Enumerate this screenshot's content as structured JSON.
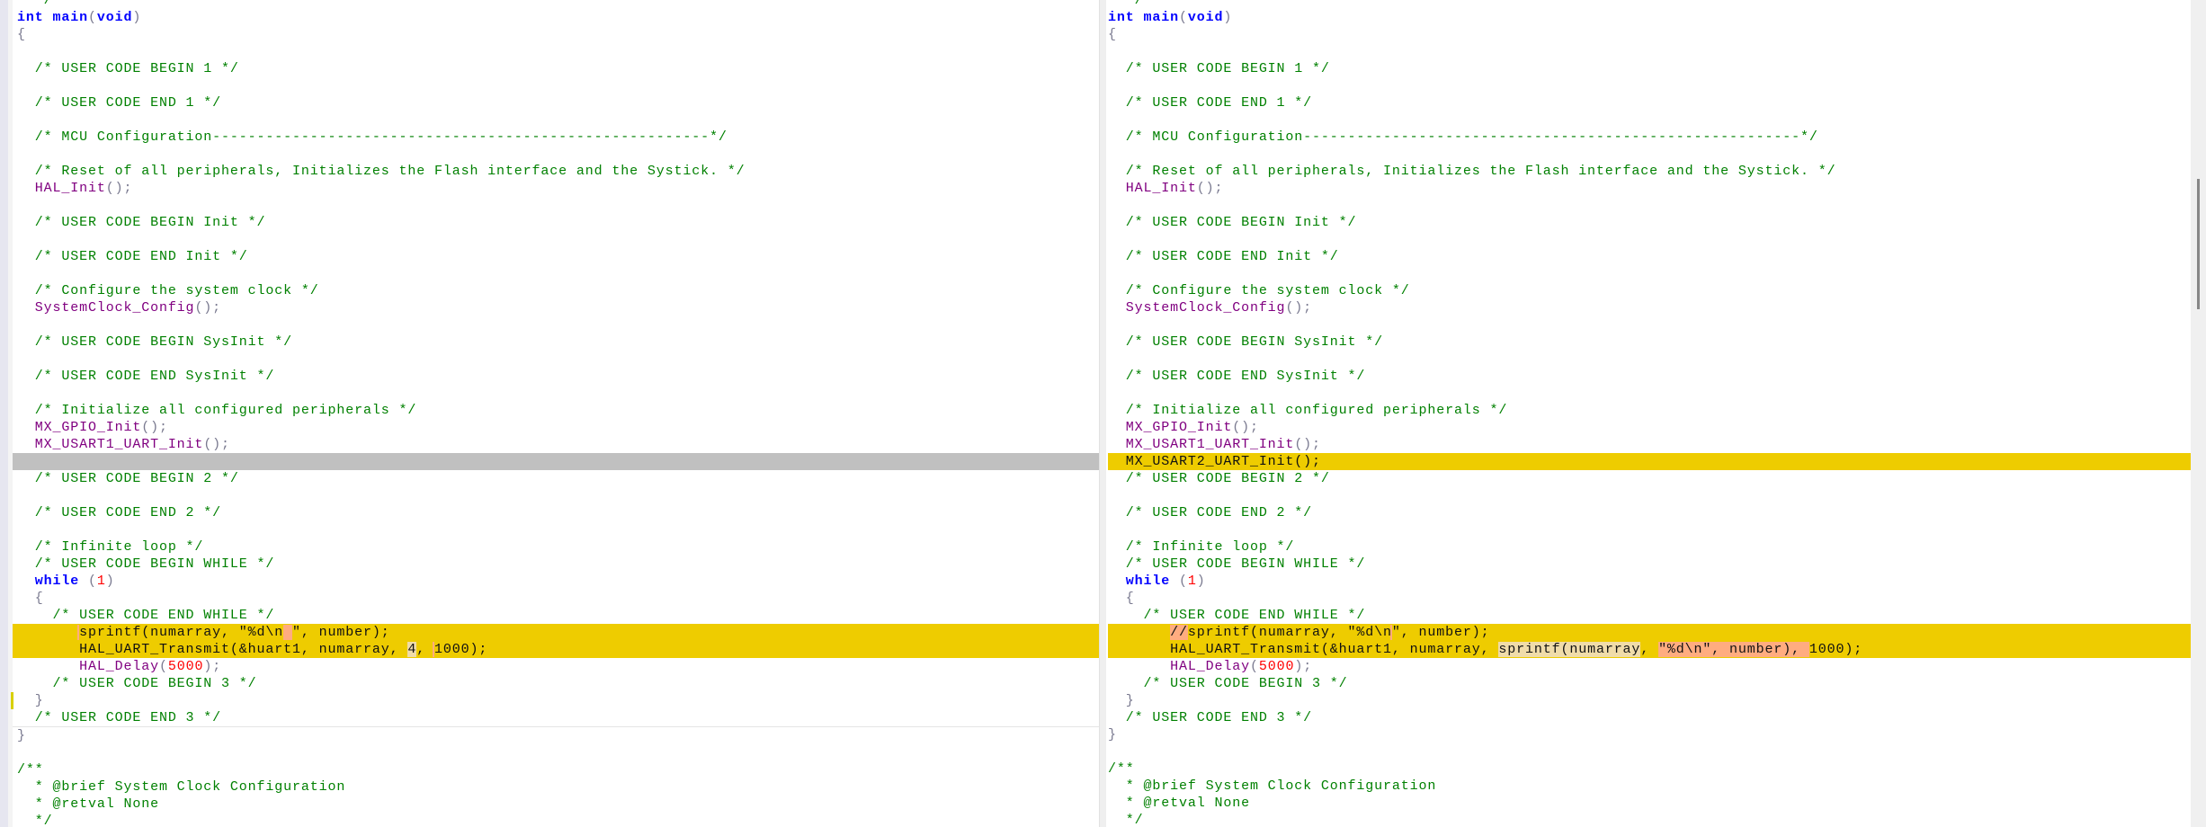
{
  "left": {
    "lines": [
      {
        "tokens": [
          {
            "t": "  */",
            "c": "c"
          }
        ]
      },
      {
        "tokens": [
          {
            "t": "int",
            "c": "k"
          },
          {
            "t": " ",
            "c": "t"
          },
          {
            "t": "main",
            "c": "k"
          },
          {
            "t": "(",
            "c": "p"
          },
          {
            "t": "void",
            "c": "k"
          },
          {
            "t": ")",
            "c": "p"
          }
        ]
      },
      {
        "tokens": [
          {
            "t": "{",
            "c": "p"
          }
        ]
      },
      {
        "tokens": []
      },
      {
        "tokens": [
          {
            "t": "  /* USER CODE BEGIN 1 */",
            "c": "c"
          }
        ]
      },
      {
        "tokens": []
      },
      {
        "tokens": [
          {
            "t": "  /* USER CODE END 1 */",
            "c": "c"
          }
        ]
      },
      {
        "tokens": []
      },
      {
        "tokens": [
          {
            "t": "  /* MCU Configuration--------------------------------------------------------*/",
            "c": "c"
          }
        ]
      },
      {
        "tokens": []
      },
      {
        "tokens": [
          {
            "t": "  /* Reset of all peripherals, Initializes the Flash interface and the Systick. */",
            "c": "c"
          }
        ]
      },
      {
        "tokens": [
          {
            "t": "  HAL_Init",
            "c": "f"
          },
          {
            "t": "();",
            "c": "p"
          }
        ]
      },
      {
        "tokens": []
      },
      {
        "tokens": [
          {
            "t": "  /* USER CODE BEGIN Init */",
            "c": "c"
          }
        ]
      },
      {
        "tokens": []
      },
      {
        "tokens": [
          {
            "t": "  /* USER CODE END Init */",
            "c": "c"
          }
        ]
      },
      {
        "tokens": []
      },
      {
        "tokens": [
          {
            "t": "  /* Configure the system clock */",
            "c": "c"
          }
        ]
      },
      {
        "tokens": [
          {
            "t": "  SystemClock_Config",
            "c": "f"
          },
          {
            "t": "();",
            "c": "p"
          }
        ]
      },
      {
        "tokens": []
      },
      {
        "tokens": [
          {
            "t": "  /* USER CODE BEGIN SysInit */",
            "c": "c"
          }
        ]
      },
      {
        "tokens": []
      },
      {
        "tokens": [
          {
            "t": "  /* USER CODE END SysInit */",
            "c": "c"
          }
        ]
      },
      {
        "tokens": []
      },
      {
        "tokens": [
          {
            "t": "  /* Initialize all configured peripherals */",
            "c": "c"
          }
        ]
      },
      {
        "tokens": [
          {
            "t": "  MX_GPIO_Init",
            "c": "f"
          },
          {
            "t": "();",
            "c": "p"
          }
        ]
      },
      {
        "tokens": [
          {
            "t": "  MX_USART1_UART_Init",
            "c": "f"
          },
          {
            "t": "();",
            "c": "p"
          }
        ]
      },
      {
        "hl": "gray",
        "tokens": []
      },
      {
        "tokens": [
          {
            "t": "  /* USER CODE BEGIN 2 */",
            "c": "c"
          }
        ]
      },
      {
        "tokens": []
      },
      {
        "tokens": [
          {
            "t": "  /* USER CODE END 2 */",
            "c": "c"
          }
        ]
      },
      {
        "tokens": []
      },
      {
        "tokens": [
          {
            "t": "  /* Infinite loop */",
            "c": "c"
          }
        ]
      },
      {
        "tokens": [
          {
            "t": "  /* USER CODE BEGIN WHILE */",
            "c": "c"
          }
        ]
      },
      {
        "tokens": [
          {
            "t": "  while",
            "c": "k"
          },
          {
            "t": " (",
            "c": "p"
          },
          {
            "t": "1",
            "c": "n"
          },
          {
            "t": ")",
            "c": "p"
          }
        ]
      },
      {
        "tokens": [
          {
            "t": "  {",
            "c": "p"
          }
        ]
      },
      {
        "tokens": [
          {
            "t": "    /* USER CODE END WHILE */",
            "c": "c"
          }
        ]
      },
      {
        "hl": "yellow",
        "tokens": [
          {
            "t": "       ",
            "c": "t"
          },
          {
            "t": "sprintf(numarray, \"%d\\n",
            "c": "t bar"
          },
          {
            "t": " ",
            "c": "hs"
          },
          {
            "t": "\", number);",
            "c": "t"
          }
        ]
      },
      {
        "hl": "yellow",
        "tokens": [
          {
            "t": "       HAL_UART_Transmit(&huart1, numarray, ",
            "c": "t"
          },
          {
            "t": "4",
            "c": "hb"
          },
          {
            "t": ", ",
            "c": "t"
          },
          {
            "t": "1000);",
            "c": "t bar"
          }
        ]
      },
      {
        "tokens": [
          {
            "t": "       HAL_Delay",
            "c": "f"
          },
          {
            "t": "(",
            "c": "p"
          },
          {
            "t": "5000",
            "c": "n"
          },
          {
            "t": ");",
            "c": "p"
          }
        ]
      },
      {
        "tokens": [
          {
            "t": "    /* USER CODE BEGIN 3 */",
            "c": "c"
          }
        ]
      },
      {
        "mark": true,
        "tokens": [
          {
            "t": "  }",
            "c": "p"
          }
        ]
      },
      {
        "sep": true,
        "tokens": [
          {
            "t": "  /* USER CODE END 3 */",
            "c": "c"
          }
        ]
      },
      {
        "tokens": [
          {
            "t": "}",
            "c": "p"
          }
        ]
      },
      {
        "tokens": []
      },
      {
        "tokens": [
          {
            "t": "/**",
            "c": "c"
          }
        ]
      },
      {
        "tokens": [
          {
            "t": "  * @brief System Clock Configuration",
            "c": "c"
          }
        ]
      },
      {
        "tokens": [
          {
            "t": "  * @retval None",
            "c": "c"
          }
        ]
      },
      {
        "tokens": [
          {
            "t": "  */",
            "c": "c"
          }
        ]
      }
    ]
  },
  "right": {
    "lines": [
      {
        "tokens": [
          {
            "t": "  */",
            "c": "c"
          }
        ]
      },
      {
        "tokens": [
          {
            "t": "int",
            "c": "k"
          },
          {
            "t": " ",
            "c": "t"
          },
          {
            "t": "main",
            "c": "k"
          },
          {
            "t": "(",
            "c": "p"
          },
          {
            "t": "void",
            "c": "k"
          },
          {
            "t": ")",
            "c": "p"
          }
        ]
      },
      {
        "tokens": [
          {
            "t": "{",
            "c": "p"
          }
        ]
      },
      {
        "tokens": []
      },
      {
        "tokens": [
          {
            "t": "  /* USER CODE BEGIN 1 */",
            "c": "c"
          }
        ]
      },
      {
        "tokens": []
      },
      {
        "tokens": [
          {
            "t": "  /* USER CODE END 1 */",
            "c": "c"
          }
        ]
      },
      {
        "tokens": []
      },
      {
        "tokens": [
          {
            "t": "  /* MCU Configuration--------------------------------------------------------*/",
            "c": "c"
          }
        ]
      },
      {
        "tokens": []
      },
      {
        "tokens": [
          {
            "t": "  /* Reset of all peripherals, Initializes the Flash interface and the Systick. */",
            "c": "c"
          }
        ]
      },
      {
        "tokens": [
          {
            "t": "  HAL_Init",
            "c": "f"
          },
          {
            "t": "();",
            "c": "p"
          }
        ]
      },
      {
        "tokens": []
      },
      {
        "tokens": [
          {
            "t": "  /* USER CODE BEGIN Init */",
            "c": "c"
          }
        ]
      },
      {
        "tokens": []
      },
      {
        "tokens": [
          {
            "t": "  /* USER CODE END Init */",
            "c": "c"
          }
        ]
      },
      {
        "tokens": []
      },
      {
        "tokens": [
          {
            "t": "  /* Configure the system clock */",
            "c": "c"
          }
        ]
      },
      {
        "tokens": [
          {
            "t": "  SystemClock_Config",
            "c": "f"
          },
          {
            "t": "();",
            "c": "p"
          }
        ]
      },
      {
        "tokens": []
      },
      {
        "tokens": [
          {
            "t": "  /* USER CODE BEGIN SysInit */",
            "c": "c"
          }
        ]
      },
      {
        "tokens": []
      },
      {
        "tokens": [
          {
            "t": "  /* USER CODE END SysInit */",
            "c": "c"
          }
        ]
      },
      {
        "tokens": []
      },
      {
        "tokens": [
          {
            "t": "  /* Initialize all configured peripherals */",
            "c": "c"
          }
        ]
      },
      {
        "tokens": [
          {
            "t": "  MX_GPIO_Init",
            "c": "f"
          },
          {
            "t": "();",
            "c": "p"
          }
        ]
      },
      {
        "tokens": [
          {
            "t": "  MX_USART1_UART_Init",
            "c": "f"
          },
          {
            "t": "();",
            "c": "p"
          }
        ]
      },
      {
        "hl": "yellow",
        "tokens": [
          {
            "t": "  MX_USART2_UART_Init();",
            "c": "t"
          }
        ]
      },
      {
        "tokens": [
          {
            "t": "  /* USER CODE BEGIN 2 */",
            "c": "c"
          }
        ]
      },
      {
        "tokens": []
      },
      {
        "tokens": [
          {
            "t": "  /* USER CODE END 2 */",
            "c": "c"
          }
        ]
      },
      {
        "tokens": []
      },
      {
        "tokens": [
          {
            "t": "  /* Infinite loop */",
            "c": "c"
          }
        ]
      },
      {
        "tokens": [
          {
            "t": "  /* USER CODE BEGIN WHILE */",
            "c": "c"
          }
        ]
      },
      {
        "tokens": [
          {
            "t": "  while",
            "c": "k"
          },
          {
            "t": " (",
            "c": "p"
          },
          {
            "t": "1",
            "c": "n"
          },
          {
            "t": ")",
            "c": "p"
          }
        ]
      },
      {
        "tokens": [
          {
            "t": "  {",
            "c": "p"
          }
        ]
      },
      {
        "tokens": [
          {
            "t": "    /* USER CODE END WHILE */",
            "c": "c"
          }
        ]
      },
      {
        "hl": "yellow",
        "mark": true,
        "tokens": [
          {
            "t": "       ",
            "c": "t"
          },
          {
            "t": "//",
            "c": "hs"
          },
          {
            "t": "sprintf(numarray, \"%d\\n",
            "c": "t"
          },
          {
            "t": "\", number);",
            "c": "t bar"
          }
        ]
      },
      {
        "hl": "yellow",
        "mark": true,
        "tokens": [
          {
            "t": "       HAL_UART_Transmit(&huart1, numarray, ",
            "c": "t"
          },
          {
            "t": "sprintf(numarray",
            "c": "hb"
          },
          {
            "t": ", ",
            "c": "t"
          },
          {
            "t": "\"%d\\n\", number), ",
            "c": "hs"
          },
          {
            "t": "1000);",
            "c": "t"
          }
        ]
      },
      {
        "mark": true,
        "tokens": [
          {
            "t": "       HAL_Delay",
            "c": "f"
          },
          {
            "t": "(",
            "c": "p"
          },
          {
            "t": "5000",
            "c": "n"
          },
          {
            "t": ");",
            "c": "p"
          }
        ]
      },
      {
        "tokens": [
          {
            "t": "    /* USER CODE BEGIN 3 */",
            "c": "c"
          }
        ]
      },
      {
        "mark": true,
        "tokens": [
          {
            "t": "  }",
            "c": "p"
          }
        ]
      },
      {
        "tokens": [
          {
            "t": "  /* USER CODE END 3 */",
            "c": "c"
          }
        ]
      },
      {
        "tokens": [
          {
            "t": "}",
            "c": "p"
          }
        ]
      },
      {
        "tokens": []
      },
      {
        "tokens": [
          {
            "t": "/**",
            "c": "c"
          }
        ]
      },
      {
        "tokens": [
          {
            "t": "  * @brief System Clock Configuration",
            "c": "c"
          }
        ]
      },
      {
        "tokens": [
          {
            "t": "  * @retval None",
            "c": "c"
          }
        ]
      },
      {
        "tokens": [
          {
            "t": "  */",
            "c": "c"
          }
        ]
      }
    ]
  },
  "colors": {
    "changed_line": "#eecc00",
    "missing_line": "#c0c0c0",
    "inline_diff": "#ffac80",
    "inline_moved": "#f0dcaa"
  }
}
